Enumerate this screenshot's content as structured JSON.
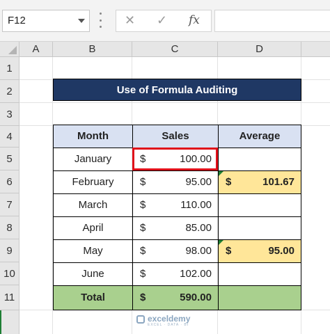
{
  "formula_bar": {
    "name_box": "F12",
    "cancel_glyph": "✕",
    "enter_glyph": "✓",
    "fx_label": "fx",
    "formula": ""
  },
  "columns": [
    "A",
    "B",
    "C",
    "D"
  ],
  "rows": [
    "1",
    "2",
    "3",
    "4",
    "5",
    "6",
    "7",
    "8",
    "9",
    "10",
    "11"
  ],
  "title": "Use of Formula Auditing",
  "table": {
    "headers": [
      "Month",
      "Sales",
      "Average"
    ],
    "currency": "$",
    "rows": [
      {
        "month": "January",
        "sales": "100.00",
        "average": ""
      },
      {
        "month": "February",
        "sales": "95.00",
        "average": "101.67"
      },
      {
        "month": "March",
        "sales": "110.00",
        "average": ""
      },
      {
        "month": "April",
        "sales": "85.00",
        "average": ""
      },
      {
        "month": "May",
        "sales": "98.00",
        "average": "95.00"
      },
      {
        "month": "June",
        "sales": "102.00",
        "average": ""
      }
    ],
    "total_label": "Total",
    "total_sales": "590.00"
  },
  "watermark": {
    "name": "exceldemy",
    "tagline": "EXCEL · DATA · BI"
  },
  "colors": {
    "title_bg": "#1f3864",
    "header_bg": "#d9e1f2",
    "average_bg": "#ffe699",
    "total_bg": "#a9d08e",
    "highlight_border": "#e0101a"
  }
}
